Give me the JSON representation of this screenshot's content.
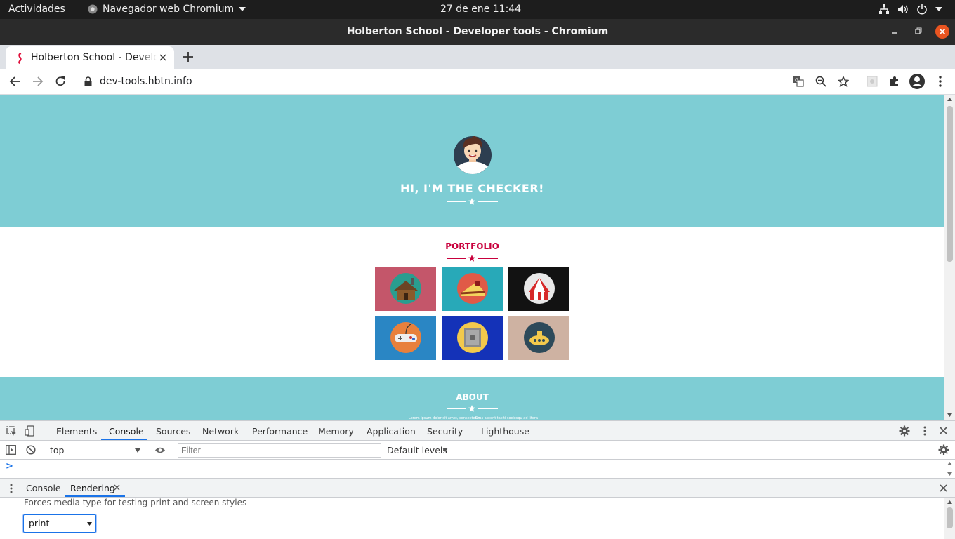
{
  "os_topbar": {
    "activities": "Actividades",
    "app_menu": "Navegador web Chromium",
    "clock": "27 de ene  11:44"
  },
  "window": {
    "title": "Holberton School - Developer tools - Chromium"
  },
  "browser": {
    "tab_title": "Holberton School - Developer tools",
    "url": "dev-tools.hbtn.info"
  },
  "page": {
    "hero_title": "HI, I'M THE CHECKER!",
    "portfolio_title": "PORTFOLIO",
    "about_title": "ABOUT",
    "about_text_left": "Lorem ipsum dolor sit amet, consectetur",
    "about_text_right": "Cras aptent taciti sociosqu ad litora",
    "colors": {
      "hero_bg": "#7ecdd4",
      "accent": "#c8003c"
    },
    "portfolio_tiles": [
      {
        "icon": "cabin-icon",
        "bg": "#c4566a"
      },
      {
        "icon": "cake-icon",
        "bg": "#28a9b8"
      },
      {
        "icon": "circus-tent-icon",
        "bg": "#121212"
      },
      {
        "icon": "game-controller-icon",
        "bg": "#2a86c4"
      },
      {
        "icon": "safe-icon",
        "bg": "#1432b8"
      },
      {
        "icon": "submarine-icon",
        "bg": "#ceb2a2"
      }
    ]
  },
  "devtools": {
    "tabs": [
      "Elements",
      "Console",
      "Sources",
      "Network",
      "Performance",
      "Memory",
      "Application",
      "Security",
      "Lighthouse"
    ],
    "active_tab": "Console",
    "context": "top",
    "filter_placeholder": "Filter",
    "levels": "Default levels",
    "prompt": ">",
    "drawer_tabs": [
      "Console",
      "Rendering"
    ],
    "drawer_active": "Rendering",
    "rendering_description": "Forces media type for testing print and screen styles",
    "media_type_value": "print"
  }
}
